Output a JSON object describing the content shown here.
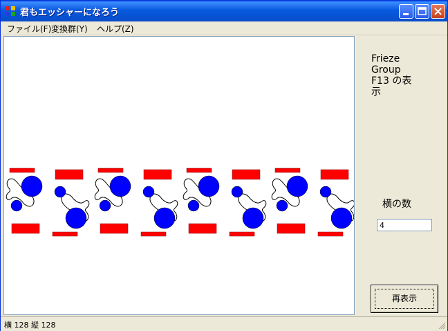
{
  "window": {
    "title": "君もエッシャーになろう"
  },
  "menu": {
    "items": [
      "ファイル(F)",
      "変換群(Y)",
      "ヘルプ(Z)"
    ]
  },
  "panel": {
    "title_lines": [
      "Frieze",
      "Group",
      "F13 の表",
      "示"
    ],
    "count_label": "横の数",
    "count_value": "4",
    "redraw_label": "再表示"
  },
  "status": {
    "text": "横 128 縦 128"
  },
  "colors": {
    "rect": "#ff0000",
    "circle": "#0000ff"
  },
  "icons": [
    "app-icon",
    "minimize-icon",
    "maximize-icon",
    "close-icon",
    "resize-grip-icon"
  ]
}
